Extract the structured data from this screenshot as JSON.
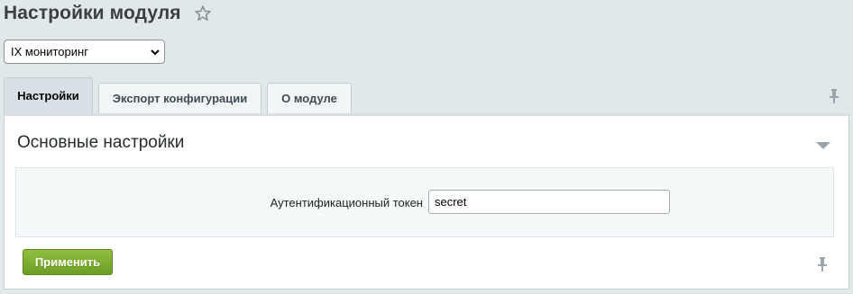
{
  "header": {
    "title": "Настройки модуля",
    "favorite_icon": "star-icon"
  },
  "module_select": {
    "selected": "IX мониторинг"
  },
  "tabs": [
    {
      "label": "Настройки",
      "active": true
    },
    {
      "label": "Экспорт конфигурации",
      "active": false
    },
    {
      "label": "О модуле",
      "active": false
    }
  ],
  "section": {
    "title": "Основные настройки",
    "collapse_icon": "triangle-down-icon"
  },
  "fields": {
    "token_label": "Аутентификационный токен",
    "token_value": "secret"
  },
  "actions": {
    "apply_label": "Применить"
  },
  "colors": {
    "background": "#e1e8ea",
    "apply_button": "#7aab2e",
    "active_tab": "#d7e0e4"
  }
}
